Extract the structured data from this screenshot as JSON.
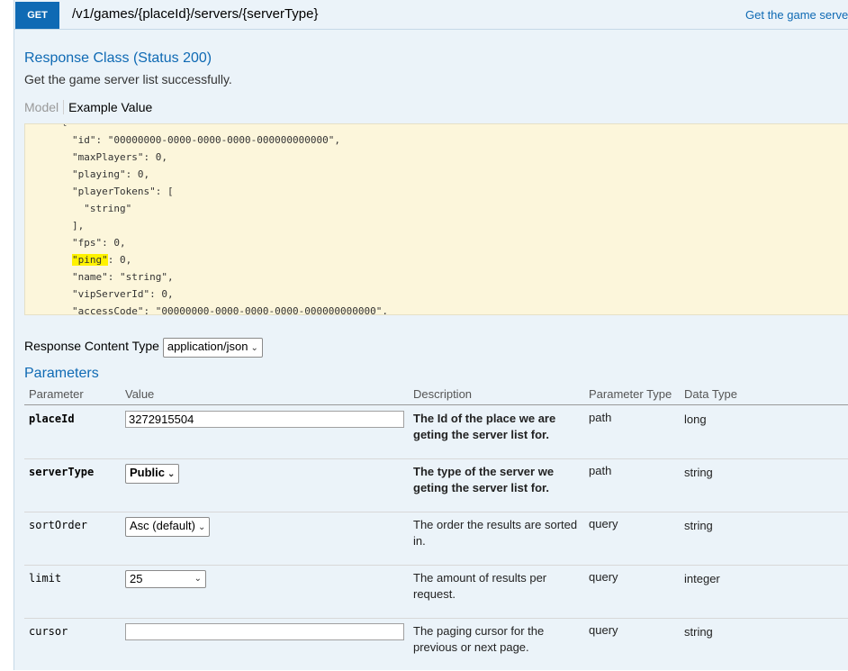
{
  "operation": {
    "method": "GET",
    "path": "/v1/games/{placeId}/servers/{serverType}",
    "summary": "Get the game server"
  },
  "response": {
    "title": "Response Class (Status 200)",
    "description": "Get the game server list successfully.",
    "tabs": {
      "model": "Model",
      "example": "Example Value"
    },
    "code_lines": [
      {
        "text": "\"id\": \"00000000-0000-0000-0000-000000000000\","
      },
      {
        "text": "\"maxPlayers\": 0,"
      },
      {
        "text": "\"playing\": 0,"
      },
      {
        "text": "\"playerTokens\": ["
      },
      {
        "text": "  \"string\""
      },
      {
        "text": "],"
      },
      {
        "text": "\"fps\": 0,"
      },
      {
        "text_hl": "\"ping\"",
        "text_rest": ": 0,"
      },
      {
        "text": "\"name\": \"string\","
      },
      {
        "text": "\"vipServerId\": 0,"
      },
      {
        "text": "\"accessCode\": \"00000000-0000-0000-0000-000000000000\","
      }
    ]
  },
  "content_type": {
    "label": "Response Content Type",
    "value": "application/json"
  },
  "parameters": {
    "title": "Parameters",
    "headers": [
      "Parameter",
      "Value",
      "Description",
      "Parameter Type",
      "Data Type"
    ],
    "rows": [
      {
        "name": "placeId",
        "value": "3272915504",
        "description": "The Id of the place we are geting the server list for.",
        "param_type": "path",
        "data_type": "long"
      },
      {
        "name": "serverType",
        "value": "Public",
        "description": "The type of the server we geting the server list for.",
        "param_type": "path",
        "data_type": "string"
      },
      {
        "name": "sortOrder",
        "value": "Asc (default)",
        "description": "The order the results are sorted in.",
        "param_type": "query",
        "data_type": "string"
      },
      {
        "name": "limit",
        "value": "25",
        "description": "The amount of results per request.",
        "param_type": "query",
        "data_type": "integer"
      },
      {
        "name": "cursor",
        "value": "",
        "description": "The paging cursor for the previous or next page.",
        "param_type": "query",
        "data_type": "string"
      }
    ]
  },
  "colors": {
    "method_badge": "#0f6ab4",
    "heading_blue": "#0f6ab4",
    "code_background": "#fcf6db",
    "panel_background": "#ebf3f9",
    "highlight": "#fff200"
  }
}
